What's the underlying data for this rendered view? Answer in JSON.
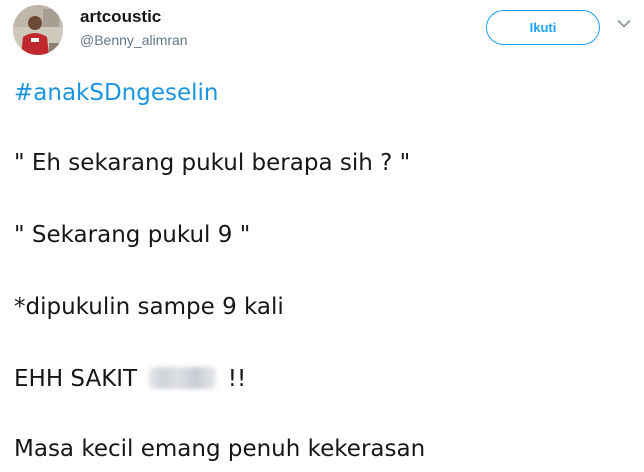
{
  "author": {
    "display_name": "artcoustic",
    "handle": "@Benny_alimran"
  },
  "follow_button": {
    "label": "Ikuti"
  },
  "tweet": {
    "hashtag": "#anakSDngeselin",
    "line_1": "\" Eh sekarang pukul berapa sih ? \"",
    "line_2": "\" Sekarang pukul 9 \"",
    "line_3": "*dipukulin sampe 9 kali",
    "line_4_prefix": "EHH SAKIT",
    "line_4_suffix": "!!",
    "line_5": "Masa kecil emang penuh kekerasan"
  },
  "colors": {
    "link": "#1b95e0",
    "follow_accent": "#1da1f2",
    "handle_gray": "#657786",
    "text": "#14171a"
  },
  "icons": {
    "avatar": "profile-photo",
    "more": "chevron-down-icon"
  }
}
